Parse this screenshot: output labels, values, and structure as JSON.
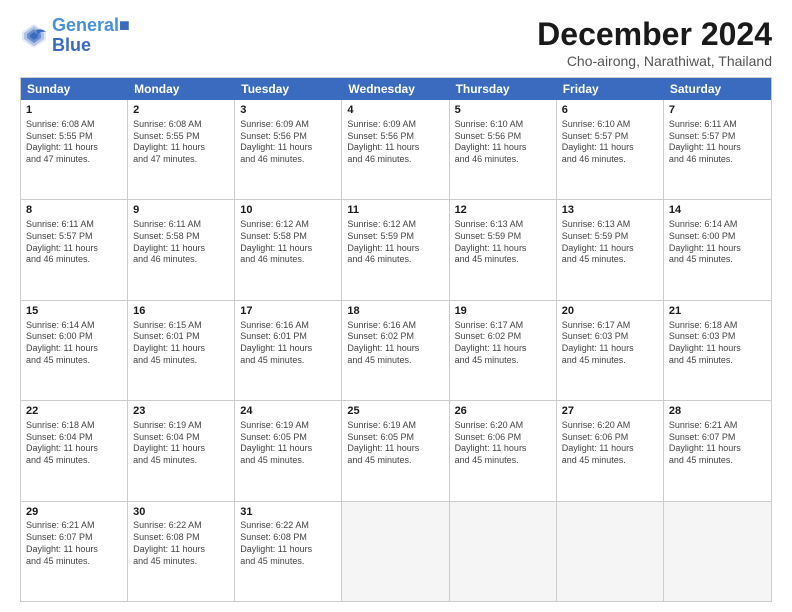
{
  "header": {
    "logo_line1": "General",
    "logo_line2": "Blue",
    "main_title": "December 2024",
    "subtitle": "Cho-airong, Narathiwat, Thailand"
  },
  "calendar": {
    "days_of_week": [
      "Sunday",
      "Monday",
      "Tuesday",
      "Wednesday",
      "Thursday",
      "Friday",
      "Saturday"
    ],
    "weeks": [
      [
        {
          "day": "",
          "info": ""
        },
        {
          "day": "",
          "info": ""
        },
        {
          "day": "",
          "info": ""
        },
        {
          "day": "",
          "info": ""
        },
        {
          "day": "",
          "info": ""
        },
        {
          "day": "",
          "info": ""
        },
        {
          "day": "",
          "info": ""
        }
      ],
      [
        {
          "day": "1",
          "info": "Sunrise: 6:08 AM\nSunset: 5:55 PM\nDaylight: 11 hours\nand 47 minutes."
        },
        {
          "day": "2",
          "info": "Sunrise: 6:08 AM\nSunset: 5:55 PM\nDaylight: 11 hours\nand 47 minutes."
        },
        {
          "day": "3",
          "info": "Sunrise: 6:09 AM\nSunset: 5:56 PM\nDaylight: 11 hours\nand 46 minutes."
        },
        {
          "day": "4",
          "info": "Sunrise: 6:09 AM\nSunset: 5:56 PM\nDaylight: 11 hours\nand 46 minutes."
        },
        {
          "day": "5",
          "info": "Sunrise: 6:10 AM\nSunset: 5:56 PM\nDaylight: 11 hours\nand 46 minutes."
        },
        {
          "day": "6",
          "info": "Sunrise: 6:10 AM\nSunset: 5:57 PM\nDaylight: 11 hours\nand 46 minutes."
        },
        {
          "day": "7",
          "info": "Sunrise: 6:11 AM\nSunset: 5:57 PM\nDaylight: 11 hours\nand 46 minutes."
        }
      ],
      [
        {
          "day": "8",
          "info": "Sunrise: 6:11 AM\nSunset: 5:57 PM\nDaylight: 11 hours\nand 46 minutes."
        },
        {
          "day": "9",
          "info": "Sunrise: 6:11 AM\nSunset: 5:58 PM\nDaylight: 11 hours\nand 46 minutes."
        },
        {
          "day": "10",
          "info": "Sunrise: 6:12 AM\nSunset: 5:58 PM\nDaylight: 11 hours\nand 46 minutes."
        },
        {
          "day": "11",
          "info": "Sunrise: 6:12 AM\nSunset: 5:59 PM\nDaylight: 11 hours\nand 46 minutes."
        },
        {
          "day": "12",
          "info": "Sunrise: 6:13 AM\nSunset: 5:59 PM\nDaylight: 11 hours\nand 45 minutes."
        },
        {
          "day": "13",
          "info": "Sunrise: 6:13 AM\nSunset: 5:59 PM\nDaylight: 11 hours\nand 45 minutes."
        },
        {
          "day": "14",
          "info": "Sunrise: 6:14 AM\nSunset: 6:00 PM\nDaylight: 11 hours\nand 45 minutes."
        }
      ],
      [
        {
          "day": "15",
          "info": "Sunrise: 6:14 AM\nSunset: 6:00 PM\nDaylight: 11 hours\nand 45 minutes."
        },
        {
          "day": "16",
          "info": "Sunrise: 6:15 AM\nSunset: 6:01 PM\nDaylight: 11 hours\nand 45 minutes."
        },
        {
          "day": "17",
          "info": "Sunrise: 6:16 AM\nSunset: 6:01 PM\nDaylight: 11 hours\nand 45 minutes."
        },
        {
          "day": "18",
          "info": "Sunrise: 6:16 AM\nSunset: 6:02 PM\nDaylight: 11 hours\nand 45 minutes."
        },
        {
          "day": "19",
          "info": "Sunrise: 6:17 AM\nSunset: 6:02 PM\nDaylight: 11 hours\nand 45 minutes."
        },
        {
          "day": "20",
          "info": "Sunrise: 6:17 AM\nSunset: 6:03 PM\nDaylight: 11 hours\nand 45 minutes."
        },
        {
          "day": "21",
          "info": "Sunrise: 6:18 AM\nSunset: 6:03 PM\nDaylight: 11 hours\nand 45 minutes."
        }
      ],
      [
        {
          "day": "22",
          "info": "Sunrise: 6:18 AM\nSunset: 6:04 PM\nDaylight: 11 hours\nand 45 minutes."
        },
        {
          "day": "23",
          "info": "Sunrise: 6:19 AM\nSunset: 6:04 PM\nDaylight: 11 hours\nand 45 minutes."
        },
        {
          "day": "24",
          "info": "Sunrise: 6:19 AM\nSunset: 6:05 PM\nDaylight: 11 hours\nand 45 minutes."
        },
        {
          "day": "25",
          "info": "Sunrise: 6:19 AM\nSunset: 6:05 PM\nDaylight: 11 hours\nand 45 minutes."
        },
        {
          "day": "26",
          "info": "Sunrise: 6:20 AM\nSunset: 6:06 PM\nDaylight: 11 hours\nand 45 minutes."
        },
        {
          "day": "27",
          "info": "Sunrise: 6:20 AM\nSunset: 6:06 PM\nDaylight: 11 hours\nand 45 minutes."
        },
        {
          "day": "28",
          "info": "Sunrise: 6:21 AM\nSunset: 6:07 PM\nDaylight: 11 hours\nand 45 minutes."
        }
      ],
      [
        {
          "day": "29",
          "info": "Sunrise: 6:21 AM\nSunset: 6:07 PM\nDaylight: 11 hours\nand 45 minutes."
        },
        {
          "day": "30",
          "info": "Sunrise: 6:22 AM\nSunset: 6:08 PM\nDaylight: 11 hours\nand 45 minutes."
        },
        {
          "day": "31",
          "info": "Sunrise: 6:22 AM\nSunset: 6:08 PM\nDaylight: 11 hours\nand 45 minutes."
        },
        {
          "day": "",
          "info": ""
        },
        {
          "day": "",
          "info": ""
        },
        {
          "day": "",
          "info": ""
        },
        {
          "day": "",
          "info": ""
        }
      ]
    ]
  }
}
